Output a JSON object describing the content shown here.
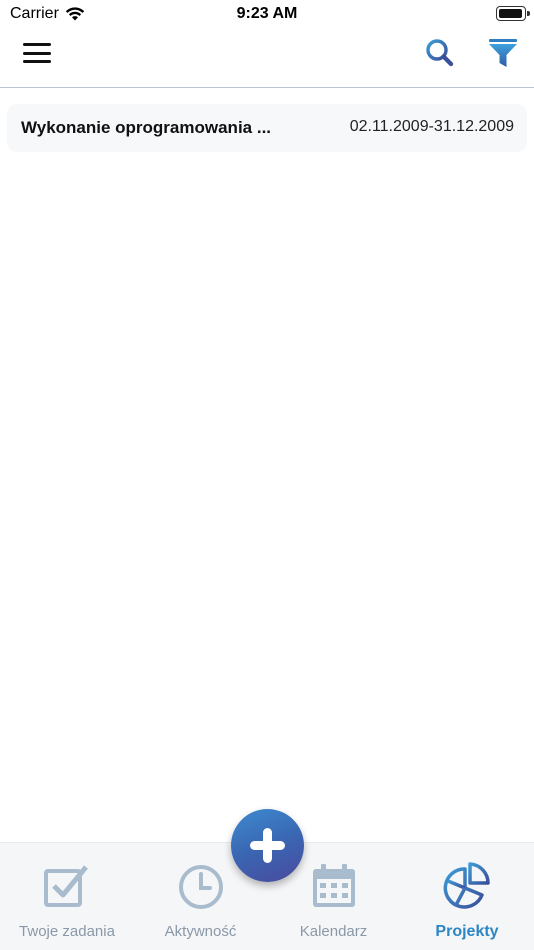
{
  "status_bar": {
    "carrier": "Carrier",
    "time": "9:23 AM"
  },
  "nav": {
    "menu_icon": "hamburger-menu-icon",
    "search_icon": "search-icon",
    "filter_icon": "filter-icon"
  },
  "projects": [
    {
      "name": "Wykonanie oprogramowania ...",
      "dates": "02.11.2009-31.12.2009"
    }
  ],
  "fab": {
    "icon": "plus-icon"
  },
  "tabs": [
    {
      "label": "Twoje zadania",
      "icon": "checkbox-icon",
      "active": false
    },
    {
      "label": "Aktywność",
      "icon": "clock-icon",
      "active": false
    },
    {
      "label": "Kalendarz",
      "icon": "calendar-icon",
      "active": false
    },
    {
      "label": "Projekty",
      "icon": "pie-chart-icon",
      "active": true
    }
  ],
  "colors": {
    "accent": "#2d86c4",
    "inactive_tab": "#8a98a8",
    "icon_inactive": "#a9bccd",
    "fab_gradient_start": "#3d8bd0",
    "fab_gradient_end": "#4a4a9e"
  }
}
